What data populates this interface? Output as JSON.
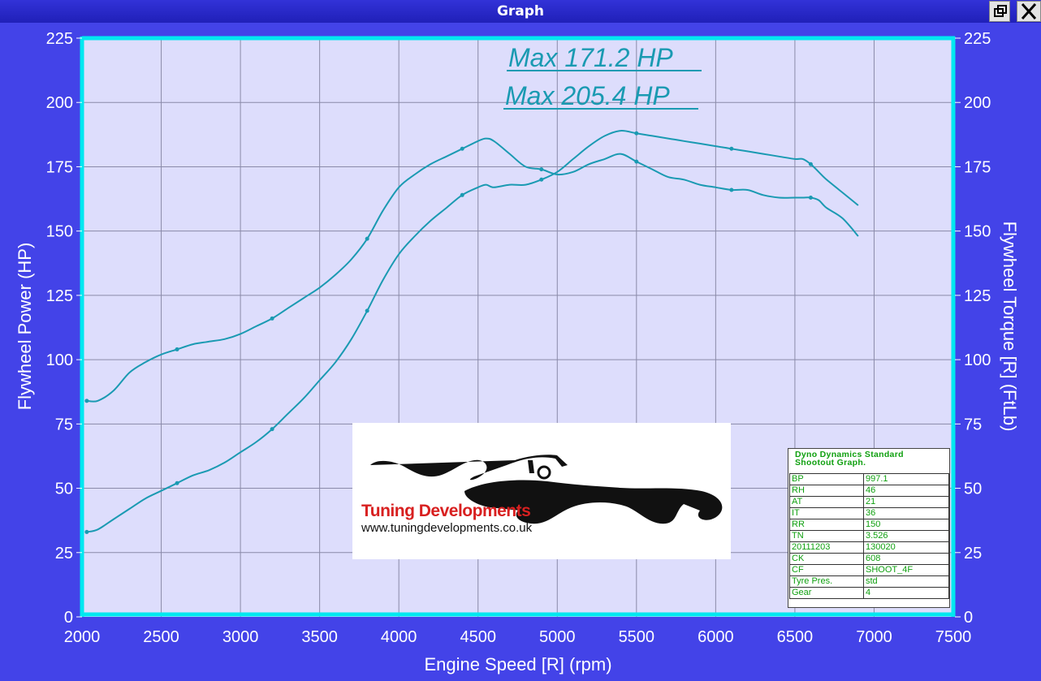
{
  "window": {
    "title": "Graph"
  },
  "annotations": {
    "max_power": "Max 171.2 HP",
    "max_torque": "Max 205.4 HP"
  },
  "logo": {
    "brand": "Tuning Developments",
    "url": "www.tuningdevelopments.co.uk"
  },
  "info_table": {
    "title_line1": "Dyno Dynamics Standard",
    "title_line2": "Shootout Graph.",
    "rows": [
      {
        "key": "BP",
        "value": "997.1"
      },
      {
        "key": "RH",
        "value": "46"
      },
      {
        "key": "AT",
        "value": "21"
      },
      {
        "key": "IT",
        "value": "36"
      },
      {
        "key": "RR",
        "value": "150"
      },
      {
        "key": "TN",
        "value": "3.526"
      },
      {
        "key": "20111203",
        "value": "130020"
      },
      {
        "key": "CK",
        "value": "608"
      },
      {
        "key": "CF",
        "value": "SHOOT_4F"
      },
      {
        "key": "Tyre Pres.",
        "value": "std"
      },
      {
        "key": "Gear",
        "value": "4"
      }
    ]
  },
  "colors": {
    "background": "#4343e8",
    "plot": "#ddddfc",
    "curve": "#1a9ab2",
    "frame": "#00e8f0",
    "text": "#ffffff",
    "annotation": "#1a9ab2"
  },
  "chart_data": {
    "type": "line",
    "xlabel": "Engine Speed [R] (rpm)",
    "ylabel": "Flywheel Power (HP)",
    "ylabel_right": "Flywheel Torque [R] (FtLb)",
    "xlim": [
      2000,
      7500
    ],
    "ylim": [
      0,
      225
    ],
    "ylim_right": [
      0,
      225
    ],
    "x_ticks": [
      2000,
      2500,
      3000,
      3500,
      4000,
      4500,
      5000,
      5500,
      6000,
      6500,
      7000,
      7500
    ],
    "y_ticks": [
      0,
      25,
      50,
      75,
      100,
      125,
      150,
      175,
      200,
      225
    ],
    "grid": true,
    "series": [
      {
        "axis": "left",
        "x": [
          2030,
          2100,
          2200,
          2300,
          2400,
          2500,
          2600,
          2700,
          2800,
          2900,
          3000,
          3100,
          3200,
          3300,
          3400,
          3500,
          3600,
          3700,
          3800,
          3900,
          4000,
          4100,
          4200,
          4300,
          4400,
          4500,
          4550,
          4600,
          4700,
          4800,
          4900,
          5000,
          5100,
          5200,
          5300,
          5400,
          5500,
          5600,
          5700,
          5800,
          5900,
          6000,
          6100,
          6200,
          6300,
          6400,
          6500,
          6550,
          6600,
          6650,
          6700,
          6800,
          6900
        ],
        "y": [
          33,
          34,
          38,
          42,
          46,
          49,
          52,
          55,
          57,
          60,
          64,
          68,
          73,
          79,
          85,
          92,
          99,
          108,
          119,
          131,
          141,
          148,
          154,
          159,
          164,
          167,
          168,
          167,
          168,
          168,
          170,
          173,
          178,
          183,
          187,
          189,
          188,
          187,
          186,
          185,
          184,
          183,
          182,
          181,
          180,
          179,
          178,
          178,
          176,
          173,
          170,
          165,
          160
        ]
      },
      {
        "axis": "right",
        "x": [
          2030,
          2100,
          2200,
          2300,
          2400,
          2500,
          2600,
          2700,
          2800,
          2900,
          3000,
          3100,
          3200,
          3300,
          3400,
          3500,
          3600,
          3700,
          3800,
          3900,
          4000,
          4100,
          4200,
          4300,
          4400,
          4500,
          4550,
          4600,
          4700,
          4800,
          4900,
          5000,
          5100,
          5200,
          5300,
          5400,
          5500,
          5600,
          5700,
          5800,
          5900,
          6000,
          6100,
          6200,
          6300,
          6400,
          6500,
          6550,
          6600,
          6650,
          6700,
          6800,
          6900
        ],
        "y": [
          84,
          84,
          88,
          95,
          99,
          102,
          104,
          106,
          107,
          108,
          110,
          113,
          116,
          120,
          124,
          128,
          133,
          139,
          147,
          158,
          167,
          172,
          176,
          179,
          182,
          185,
          186,
          185,
          180,
          175,
          174,
          172,
          173,
          176,
          178,
          180,
          177,
          174,
          171,
          170,
          168,
          167,
          166,
          166,
          164,
          163,
          163,
          163,
          163,
          162,
          159,
          155,
          148
        ]
      }
    ]
  }
}
